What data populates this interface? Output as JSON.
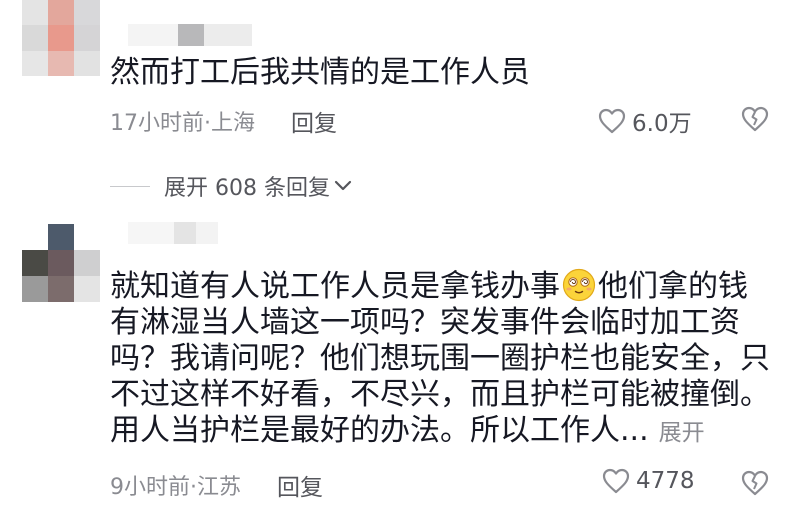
{
  "comments": [
    {
      "text": "然而打工后我共情的是工作人员",
      "time_location": "17小时前·上海",
      "reply_label": "回复",
      "like_count": "6.0万"
    },
    {
      "text_part1": "就知道有人说工作人员是拿钱办事",
      "text_part2": "他们拿的钱有淋湿当人墙这一项吗？突发事件会临时加工资吗？我请问呢？他们想玩围一圈护栏也能安全，只不过这样不好看，不尽兴，而且护栏可能被撞倒。用人当护栏是最好的办法。所以工作人...",
      "expand_label": "展开",
      "time_location": "9小时前·江苏",
      "reply_label": "回复",
      "like_count": "4778"
    }
  ],
  "replies_expander": {
    "label": "展开 608 条回复"
  },
  "icons": {
    "like": "heart-outline-icon",
    "dislike": "broken-heart-icon",
    "chevron": "chevron-down-icon",
    "emoji": "dazed-face-emoji"
  },
  "colors": {
    "text_primary": "#161823",
    "text_secondary": "#8a8b91",
    "action": "#55565c"
  }
}
